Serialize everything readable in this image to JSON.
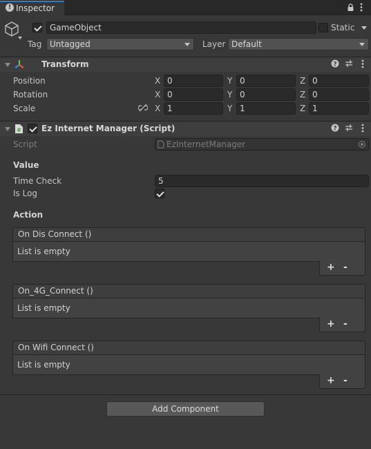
{
  "tab": {
    "title": "Inspector",
    "icons": [
      "info-icon",
      "lock-icon",
      "menu-icon"
    ]
  },
  "object": {
    "name": "GameObject",
    "active": true,
    "static_label": "Static",
    "static_checked": false,
    "tag_label": "Tag",
    "tag_value": "Untagged",
    "layer_label": "Layer",
    "layer_value": "Default"
  },
  "transform": {
    "title": "Transform",
    "rows": [
      {
        "label": "Position",
        "x": "0",
        "y": "0",
        "z": "0"
      },
      {
        "label": "Rotation",
        "x": "0",
        "y": "0",
        "z": "0"
      },
      {
        "label": "Scale",
        "x": "1",
        "y": "1",
        "z": "1"
      }
    ],
    "axis": {
      "x": "X",
      "y": "Y",
      "z": "Z"
    }
  },
  "script_component": {
    "title": "Ez Internet Manager (Script)",
    "enabled": true,
    "script_label": "Script",
    "script_value": "EzInternetManager",
    "value_header": "Value",
    "time_check_label": "Time Check",
    "time_check_value": "5",
    "is_log_label": "Is Log",
    "is_log_checked": true,
    "action_header": "Action",
    "events": [
      {
        "name": "On Dis Connect ()",
        "body": "List is empty"
      },
      {
        "name": "On_4G_Connect ()",
        "body": "List is empty"
      },
      {
        "name": "On Wifi Connect ()",
        "body": "List is empty"
      }
    ],
    "plus": "+",
    "minus": "-"
  },
  "add_component_label": "Add Component",
  "colors": {
    "background": "#383838",
    "header": "#3e3e3e",
    "field": "#2a2a2a",
    "button": "#585858"
  }
}
